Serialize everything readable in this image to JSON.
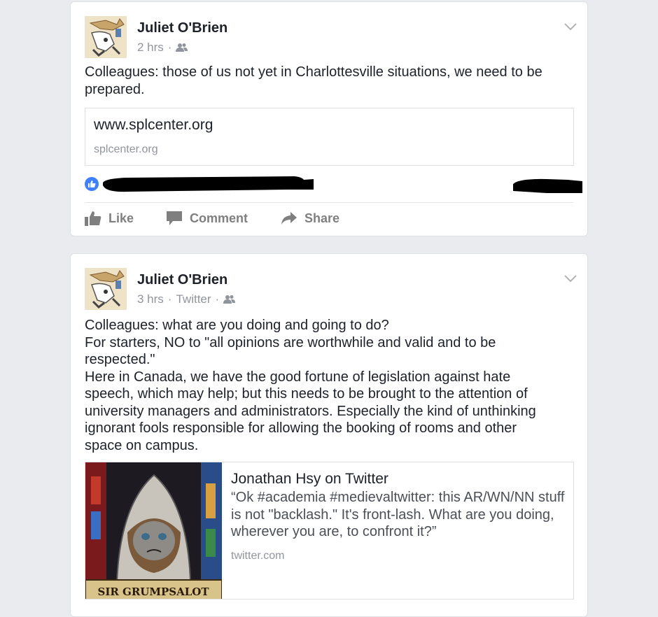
{
  "posts": [
    {
      "author": "Juliet O'Brien",
      "time": "2 hrs",
      "source": "",
      "text": "Colleagues: those of us not yet in Charlottesville situations, we need to be\nprepared.",
      "link": {
        "title": "www.splcenter.org",
        "domain": "splcenter.org"
      },
      "actions": {
        "like": "Like",
        "comment": "Comment",
        "share": "Share"
      }
    },
    {
      "author": "Juliet O'Brien",
      "time": "3 hrs",
      "source": "Twitter",
      "text": "Colleagues: what are you doing and going to do?\nFor starters, NO to \"all opinions are worthwhile and valid and to be\nrespected.\"\nHere in Canada, we have the good fortune of legislation against hate\nspeech, which may help; but this needs to be brought to the attention of\nuniversity managers and administrators. Especially the kind of unthinking\nignorant fools responsible for allowing the booking of rooms and other\nspace on campus.",
      "shared": {
        "title": "Jonathan Hsy on Twitter",
        "quote": "“Ok #academia #medievaltwitter: this AR/WN/NN stuff is not \"backlash.\" It's front-lash. What are you doing, wherever you are, to confront it?”",
        "domain": "twitter.com",
        "image_caption": "SIR GRUMPSALOT"
      }
    }
  ],
  "colors": {
    "background": "#e9ebee",
    "card": "#ffffff",
    "text": "#1d2129",
    "meta": "#90949c",
    "like_blue": "#4080ff",
    "action_grey": "#7f7f7f"
  },
  "icons": [
    "chevron-down-icon",
    "friends-icon",
    "like-badge-icon",
    "like-icon",
    "comment-icon",
    "share-icon"
  ]
}
